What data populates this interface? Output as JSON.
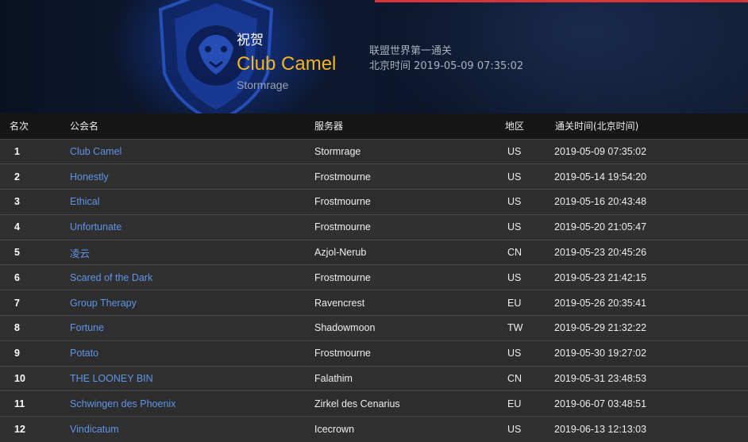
{
  "banner": {
    "congrats": "祝贺",
    "guild_name": "Club Camel",
    "realm": "Stormrage",
    "achievement": "联盟世界第一通关",
    "time_text": "北京时间 2019-05-09 07:35:02",
    "colors": {
      "accent": "#f5b51f",
      "link": "#5f95e8",
      "top_line": "#d9333b"
    }
  },
  "table": {
    "headers": {
      "rank": "名次",
      "guild": "公会名",
      "server": "服务器",
      "region": "地区",
      "time": "通关时间(北京时间)"
    },
    "rows": [
      {
        "rank": "1",
        "guild": "Club Camel",
        "server": "Stormrage",
        "region": "US",
        "time": "2019-05-09 07:35:02"
      },
      {
        "rank": "2",
        "guild": "Honestly",
        "server": "Frostmourne",
        "region": "US",
        "time": "2019-05-14 19:54:20"
      },
      {
        "rank": "3",
        "guild": "Ethical",
        "server": "Frostmourne",
        "region": "US",
        "time": "2019-05-16 20:43:48"
      },
      {
        "rank": "4",
        "guild": "Unfortunate",
        "server": "Frostmourne",
        "region": "US",
        "time": "2019-05-20 21:05:47"
      },
      {
        "rank": "5",
        "guild": "凌云",
        "server": "Azjol-Nerub",
        "region": "CN",
        "time": "2019-05-23 20:45:26"
      },
      {
        "rank": "6",
        "guild": "Scared of the Dark",
        "server": "Frostmourne",
        "region": "US",
        "time": "2019-05-23 21:42:15"
      },
      {
        "rank": "7",
        "guild": "Group Therapy",
        "server": "Ravencrest",
        "region": "EU",
        "time": "2019-05-26 20:35:41"
      },
      {
        "rank": "8",
        "guild": "Fortune",
        "server": "Shadowmoon",
        "region": "TW",
        "time": "2019-05-29 21:32:22"
      },
      {
        "rank": "9",
        "guild": "Potato",
        "server": "Frostmourne",
        "region": "US",
        "time": "2019-05-30 19:27:02"
      },
      {
        "rank": "10",
        "guild": "THE LOONEY BIN",
        "server": "Falathim",
        "region": "CN",
        "time": "2019-05-31 23:48:53"
      },
      {
        "rank": "11",
        "guild": "Schwingen des Phoenix",
        "server": "Zirkel des Cenarius",
        "region": "EU",
        "time": "2019-06-07 03:48:51"
      },
      {
        "rank": "12",
        "guild": "Vindicatum",
        "server": "Icecrown",
        "region": "US",
        "time": "2019-06-13 12:13:03"
      }
    ]
  },
  "icons": {
    "crest": "alliance-lion-crest-icon"
  }
}
